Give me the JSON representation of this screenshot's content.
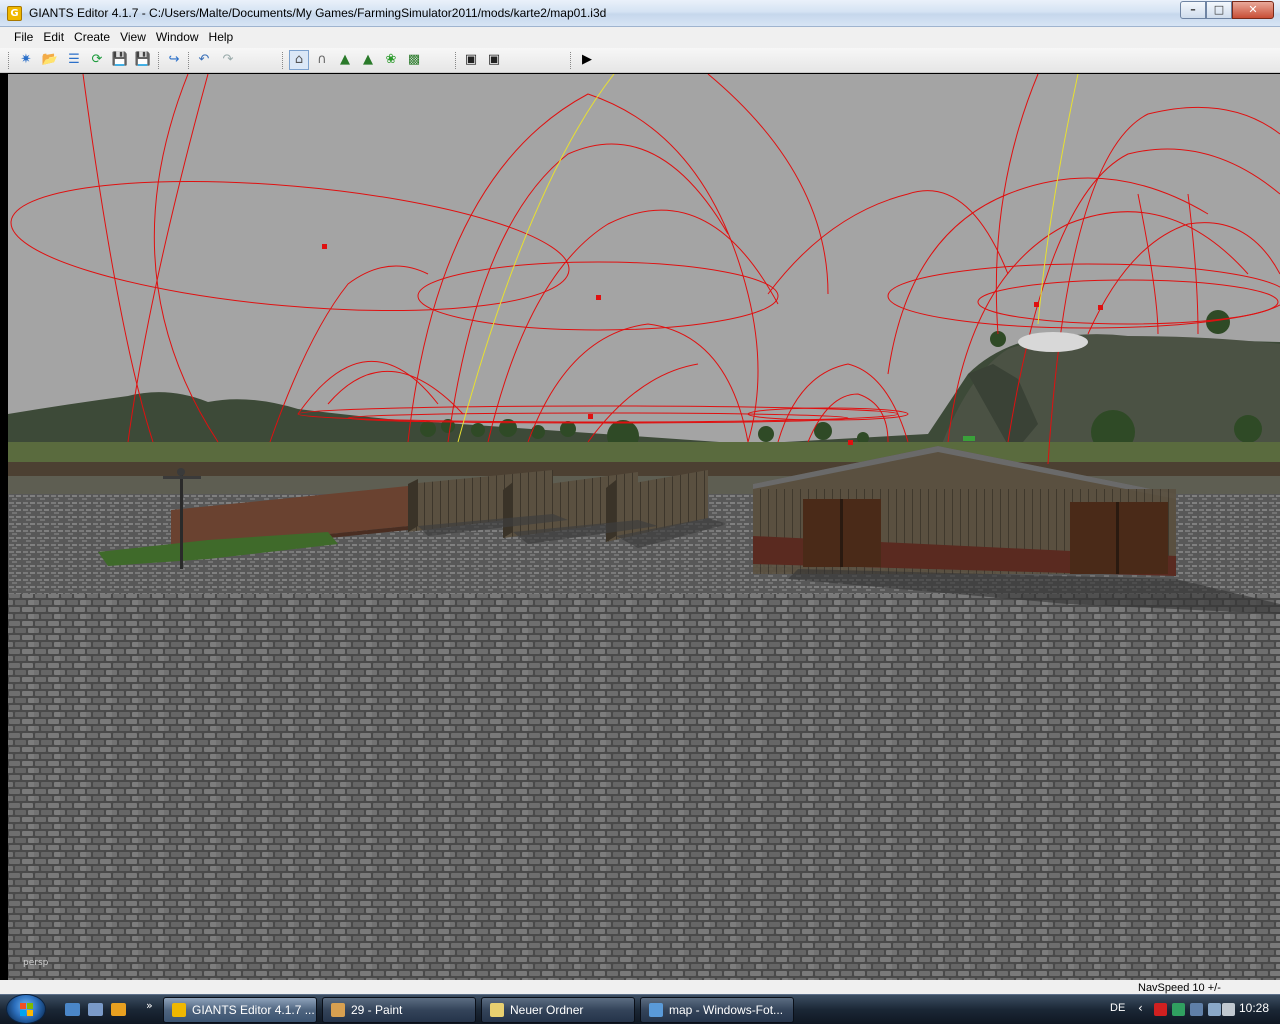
{
  "window": {
    "title": "GIANTS Editor 4.1.7 - C:/Users/Malte/Documents/My Games/FarmingSimulator2011/mods/karte2/map01.i3d",
    "icon": "giants-editor-app-icon",
    "controls": [
      "minimize",
      "maximize",
      "close"
    ]
  },
  "menu": [
    {
      "label": "File"
    },
    {
      "label": "Edit"
    },
    {
      "label": "Create"
    },
    {
      "label": "View"
    },
    {
      "label": "Window"
    },
    {
      "label": "Help"
    }
  ],
  "toolbar": {
    "buttons": [
      "new-icon",
      "open-icon",
      "properties-icon",
      "refresh-icon",
      "save-icon",
      "save-all-icon",
      "import-icon",
      "undo-icon",
      "redo-icon",
      "select-tool-icon",
      "move-tool-icon",
      "terrain-sculpt-icon",
      "terrain-paint-icon",
      "foliage-paint-icon",
      "texture-paint-icon",
      "render-icon",
      "render-settings-icon",
      "play-icon"
    ],
    "active_tool": "select-tool-icon"
  },
  "viewport": {
    "camera_label": "persp",
    "scene": "3D farm map: cobblestone yard, barn, silage bunker walls, brick wall, scarecrow, hills with trees, red light-range gizmos"
  },
  "status": {
    "nav_speed": "NavSpeed 10 +/-"
  },
  "taskbar": {
    "tasks": [
      {
        "label": "GIANTS Editor 4.1.7 ...",
        "icon": "giants-editor-icon",
        "active": true
      },
      {
        "label": "29 - Paint",
        "icon": "paint-icon",
        "active": false
      },
      {
        "label": "Neuer Ordner",
        "icon": "folder-icon",
        "active": false
      },
      {
        "label": "map - Windows-Fot...",
        "icon": "photo-viewer-icon",
        "active": false
      }
    ],
    "language": "DE",
    "clock": "10:28"
  },
  "colors": {
    "gizmo": "#e01010",
    "gizmo_yellow": "#e8e030",
    "sky": "#a4a4a4"
  }
}
